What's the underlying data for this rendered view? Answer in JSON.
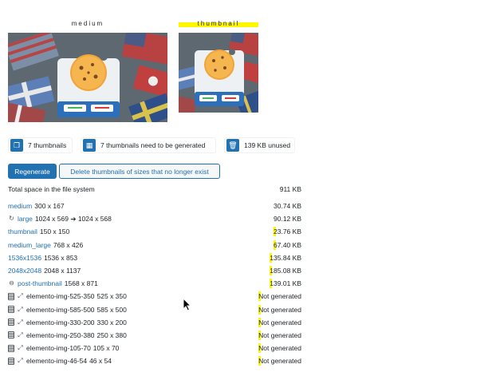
{
  "thumbnails": [
    {
      "label": "medium"
    },
    {
      "label": "thumbnail"
    }
  ],
  "stats": [
    {
      "icon": "images-icon",
      "text": "7 thumbnails"
    },
    {
      "icon": "regenerate-needed-icon",
      "text": "7 thumbnails need to be generated"
    },
    {
      "icon": "trash-icon",
      "text": "139 KB unused"
    }
  ],
  "buttons": {
    "regenerate": "Regenerate",
    "delete_unused": "Delete thumbnails of sizes that no longer exist"
  },
  "total": {
    "label": "Total space in the file system",
    "value": "911 KB"
  },
  "rows": [
    {
      "icon": "",
      "name": "medium",
      "dims": "300 x 167",
      "value": "30.74 KB"
    },
    {
      "icon": "refresh-icon",
      "name": "large",
      "dims": "1024 x 569 ➔ 1024 x 568",
      "value": "90.12 KB"
    },
    {
      "icon": "",
      "name": "thumbnail",
      "dims": "150 x 150",
      "value": "23.76 KB"
    },
    {
      "icon": "",
      "name": "medium_large",
      "dims": "768 x 426",
      "value": "67.40 KB"
    },
    {
      "icon": "",
      "name": "1536x1536",
      "dims": "1536 x 853",
      "value": "135.84 KB"
    },
    {
      "icon": "",
      "name": "2048x2048",
      "dims": "2048 x 1137",
      "value": "185.08 KB"
    },
    {
      "icon": "minus-circle-icon",
      "name": "post-thumbnail",
      "dims": "1568 x 871",
      "value": "139.01 KB"
    },
    {
      "icon": "list-icon",
      "name": "elemento-img-525-350",
      "dims": "525 x 350",
      "value": "Not generated"
    },
    {
      "icon": "list-icon",
      "name": "elemento-img-585-500",
      "dims": "585 x 500",
      "value": "Not generated"
    },
    {
      "icon": "list-icon",
      "name": "elemento-img-330-200",
      "dims": "330 x 200",
      "value": "Not generated"
    },
    {
      "icon": "list-icon",
      "name": "elemento-img-250-380",
      "dims": "250 x 380",
      "value": "Not generated"
    },
    {
      "icon": "list-icon",
      "name": "elemento-img-105-70",
      "dims": "105 x 70",
      "value": "Not generated"
    },
    {
      "icon": "list-icon",
      "name": "elemento-img-46-54",
      "dims": "46 x 54",
      "value": "Not generated"
    }
  ],
  "colors": {
    "accent": "#2271b1",
    "highlight": "#fff700"
  }
}
